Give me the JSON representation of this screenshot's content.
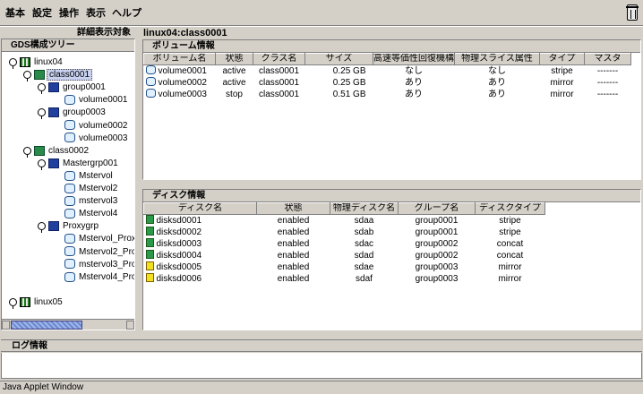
{
  "menu": [
    "基本",
    "設定",
    "操作",
    "表示",
    "ヘルプ"
  ],
  "left": {
    "header": "詳細表示対象",
    "title": "GDS構成ツリー",
    "tree": [
      {
        "label": "linux04",
        "icon": "host",
        "depth": 0,
        "toggle": true
      },
      {
        "label": "class0001",
        "icon": "class",
        "depth": 1,
        "toggle": true,
        "selected": true
      },
      {
        "label": "group0001",
        "icon": "group",
        "depth": 2,
        "toggle": true
      },
      {
        "label": "volume0001",
        "icon": "volume",
        "depth": 3,
        "toggle": false
      },
      {
        "label": "group0003",
        "icon": "group",
        "depth": 2,
        "toggle": true
      },
      {
        "label": "volume0002",
        "icon": "volume",
        "depth": 3,
        "toggle": false
      },
      {
        "label": "volume0003",
        "icon": "volume",
        "depth": 3,
        "toggle": false
      },
      {
        "label": "class0002",
        "icon": "class",
        "depth": 1,
        "toggle": true
      },
      {
        "label": "Mastergrp001",
        "icon": "group",
        "depth": 2,
        "toggle": true
      },
      {
        "label": "Mstervol",
        "icon": "volume",
        "depth": 3,
        "toggle": false
      },
      {
        "label": "Mstervol2",
        "icon": "volume",
        "depth": 3,
        "toggle": false
      },
      {
        "label": "mstervol3",
        "icon": "volume",
        "depth": 3,
        "toggle": false
      },
      {
        "label": "Mstervol4",
        "icon": "volume",
        "depth": 3,
        "toggle": false
      },
      {
        "label": "Proxygrp",
        "icon": "group",
        "depth": 2,
        "toggle": true
      },
      {
        "label": "Mstervol_Prox",
        "icon": "volume",
        "depth": 3,
        "toggle": false
      },
      {
        "label": "Mstervol2_Pro",
        "icon": "volume",
        "depth": 3,
        "toggle": false
      },
      {
        "label": "mstervol3_Pro",
        "icon": "volume",
        "depth": 3,
        "toggle": false
      },
      {
        "label": "Mstervol4_Pro",
        "icon": "volume",
        "depth": 3,
        "toggle": false
      },
      {
        "label": "",
        "icon": "none",
        "depth": 0,
        "toggle": false
      },
      {
        "label": "linux05",
        "icon": "host",
        "depth": 0,
        "toggle": true,
        "collapsed": true
      }
    ]
  },
  "right": {
    "header": "linux04:class0001",
    "volume": {
      "title": "ボリューム情報",
      "columns": [
        "ボリューム名",
        "状態",
        "クラス名",
        "サイズ",
        "高速等価性回復機構",
        "物理スライス属性",
        "タイプ",
        "マスタ"
      ],
      "rows": [
        [
          "volume0001",
          "active",
          "class0001",
          "0.25 GB",
          "なし",
          "なし",
          "stripe",
          "-------"
        ],
        [
          "volume0002",
          "active",
          "class0001",
          "0.25 GB",
          "あり",
          "あり",
          "mirror",
          "-------"
        ],
        [
          "volume0003",
          "stop",
          "class0001",
          "0.51 GB",
          "あり",
          "あり",
          "mirror",
          "-------"
        ]
      ]
    },
    "disk": {
      "title": "ディスク情報",
      "columns": [
        "ディスク名",
        "状態",
        "物理ディスク名",
        "グループ名",
        "ディスクタイプ"
      ],
      "rows": [
        [
          "disksd0001",
          "enabled",
          "sdaa",
          "group0001",
          "stripe"
        ],
        [
          "disksd0002",
          "enabled",
          "sdab",
          "group0001",
          "stripe"
        ],
        [
          "disksd0003",
          "enabled",
          "sdac",
          "group0002",
          "concat"
        ],
        [
          "disksd0004",
          "enabled",
          "sdad",
          "group0002",
          "concat"
        ],
        [
          "disksd0005",
          "enabled",
          "sdae",
          "group0003",
          "mirror"
        ],
        [
          "disksd0006",
          "enabled",
          "sdaf",
          "group0003",
          "mirror"
        ]
      ]
    }
  },
  "log": {
    "title": "ログ情報"
  },
  "status": "Java Applet Window"
}
